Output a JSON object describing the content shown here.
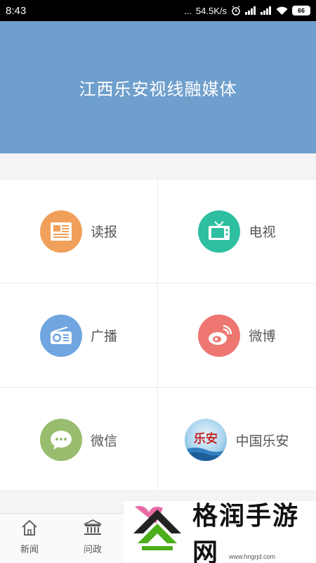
{
  "status_bar": {
    "time": "8:43",
    "dots": "...",
    "network_speed": "54.5K/s",
    "battery": "66"
  },
  "header": {
    "title": "江西乐安视线融媒体"
  },
  "grid": {
    "items": [
      {
        "label": "读报",
        "icon": "newspaper-icon",
        "color": "#f0a05a"
      },
      {
        "label": "电视",
        "icon": "tv-icon",
        "color": "#2dbfa0"
      },
      {
        "label": "广播",
        "icon": "radio-icon",
        "color": "#6fa5e0"
      },
      {
        "label": "微博",
        "icon": "weibo-icon",
        "color": "#ee7670"
      },
      {
        "label": "微信",
        "icon": "wechat-icon",
        "color": "#98bd6f"
      },
      {
        "label": "中国乐安",
        "icon": "china-lean-logo-icon",
        "logo_text": "乐安"
      }
    ]
  },
  "bottom_nav": [
    {
      "label": "新闻",
      "icon": "home-icon"
    },
    {
      "label": "问政",
      "icon": "government-icon"
    }
  ],
  "ad_overlay": {
    "text": "格润手游网",
    "url": "www.hngrjd.com"
  }
}
